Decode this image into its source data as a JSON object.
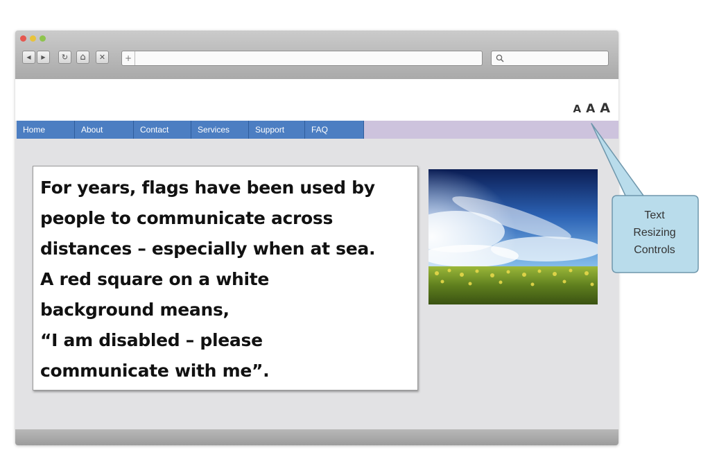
{
  "toolbar": {
    "back_glyph": "◀",
    "forward_glyph": "▶",
    "reload_glyph": "↻",
    "home_glyph": "⌂",
    "stop_glyph": "✕",
    "new_tab_glyph": "+",
    "icons": [
      "back-icon",
      "forward-icon",
      "reload-icon",
      "home-icon",
      "close-icon",
      "plus-icon",
      "search-icon"
    ]
  },
  "text_resize": {
    "small": "A",
    "medium": "A",
    "large": "A"
  },
  "nav": {
    "items": [
      {
        "label": "Home"
      },
      {
        "label": "About"
      },
      {
        "label": "Contact"
      },
      {
        "label": "Services"
      },
      {
        "label": "Support"
      },
      {
        "label": "FAQ"
      }
    ]
  },
  "main": {
    "text": "For years, flags have been used by\npeople to communicate across\ndistances – especially when at sea.\nA red square on a white\nbackground means,\n“I am disabled – please\ncommunicate with me”."
  },
  "callout": {
    "line1": "Text",
    "line2": "Resizing",
    "line3": "Controls"
  },
  "colors": {
    "nav_bg": "#4c7ec2",
    "nav_strip": "#cdc3dd",
    "callout_fill": "#b9dceb",
    "page_bg": "#e2e2e4"
  }
}
